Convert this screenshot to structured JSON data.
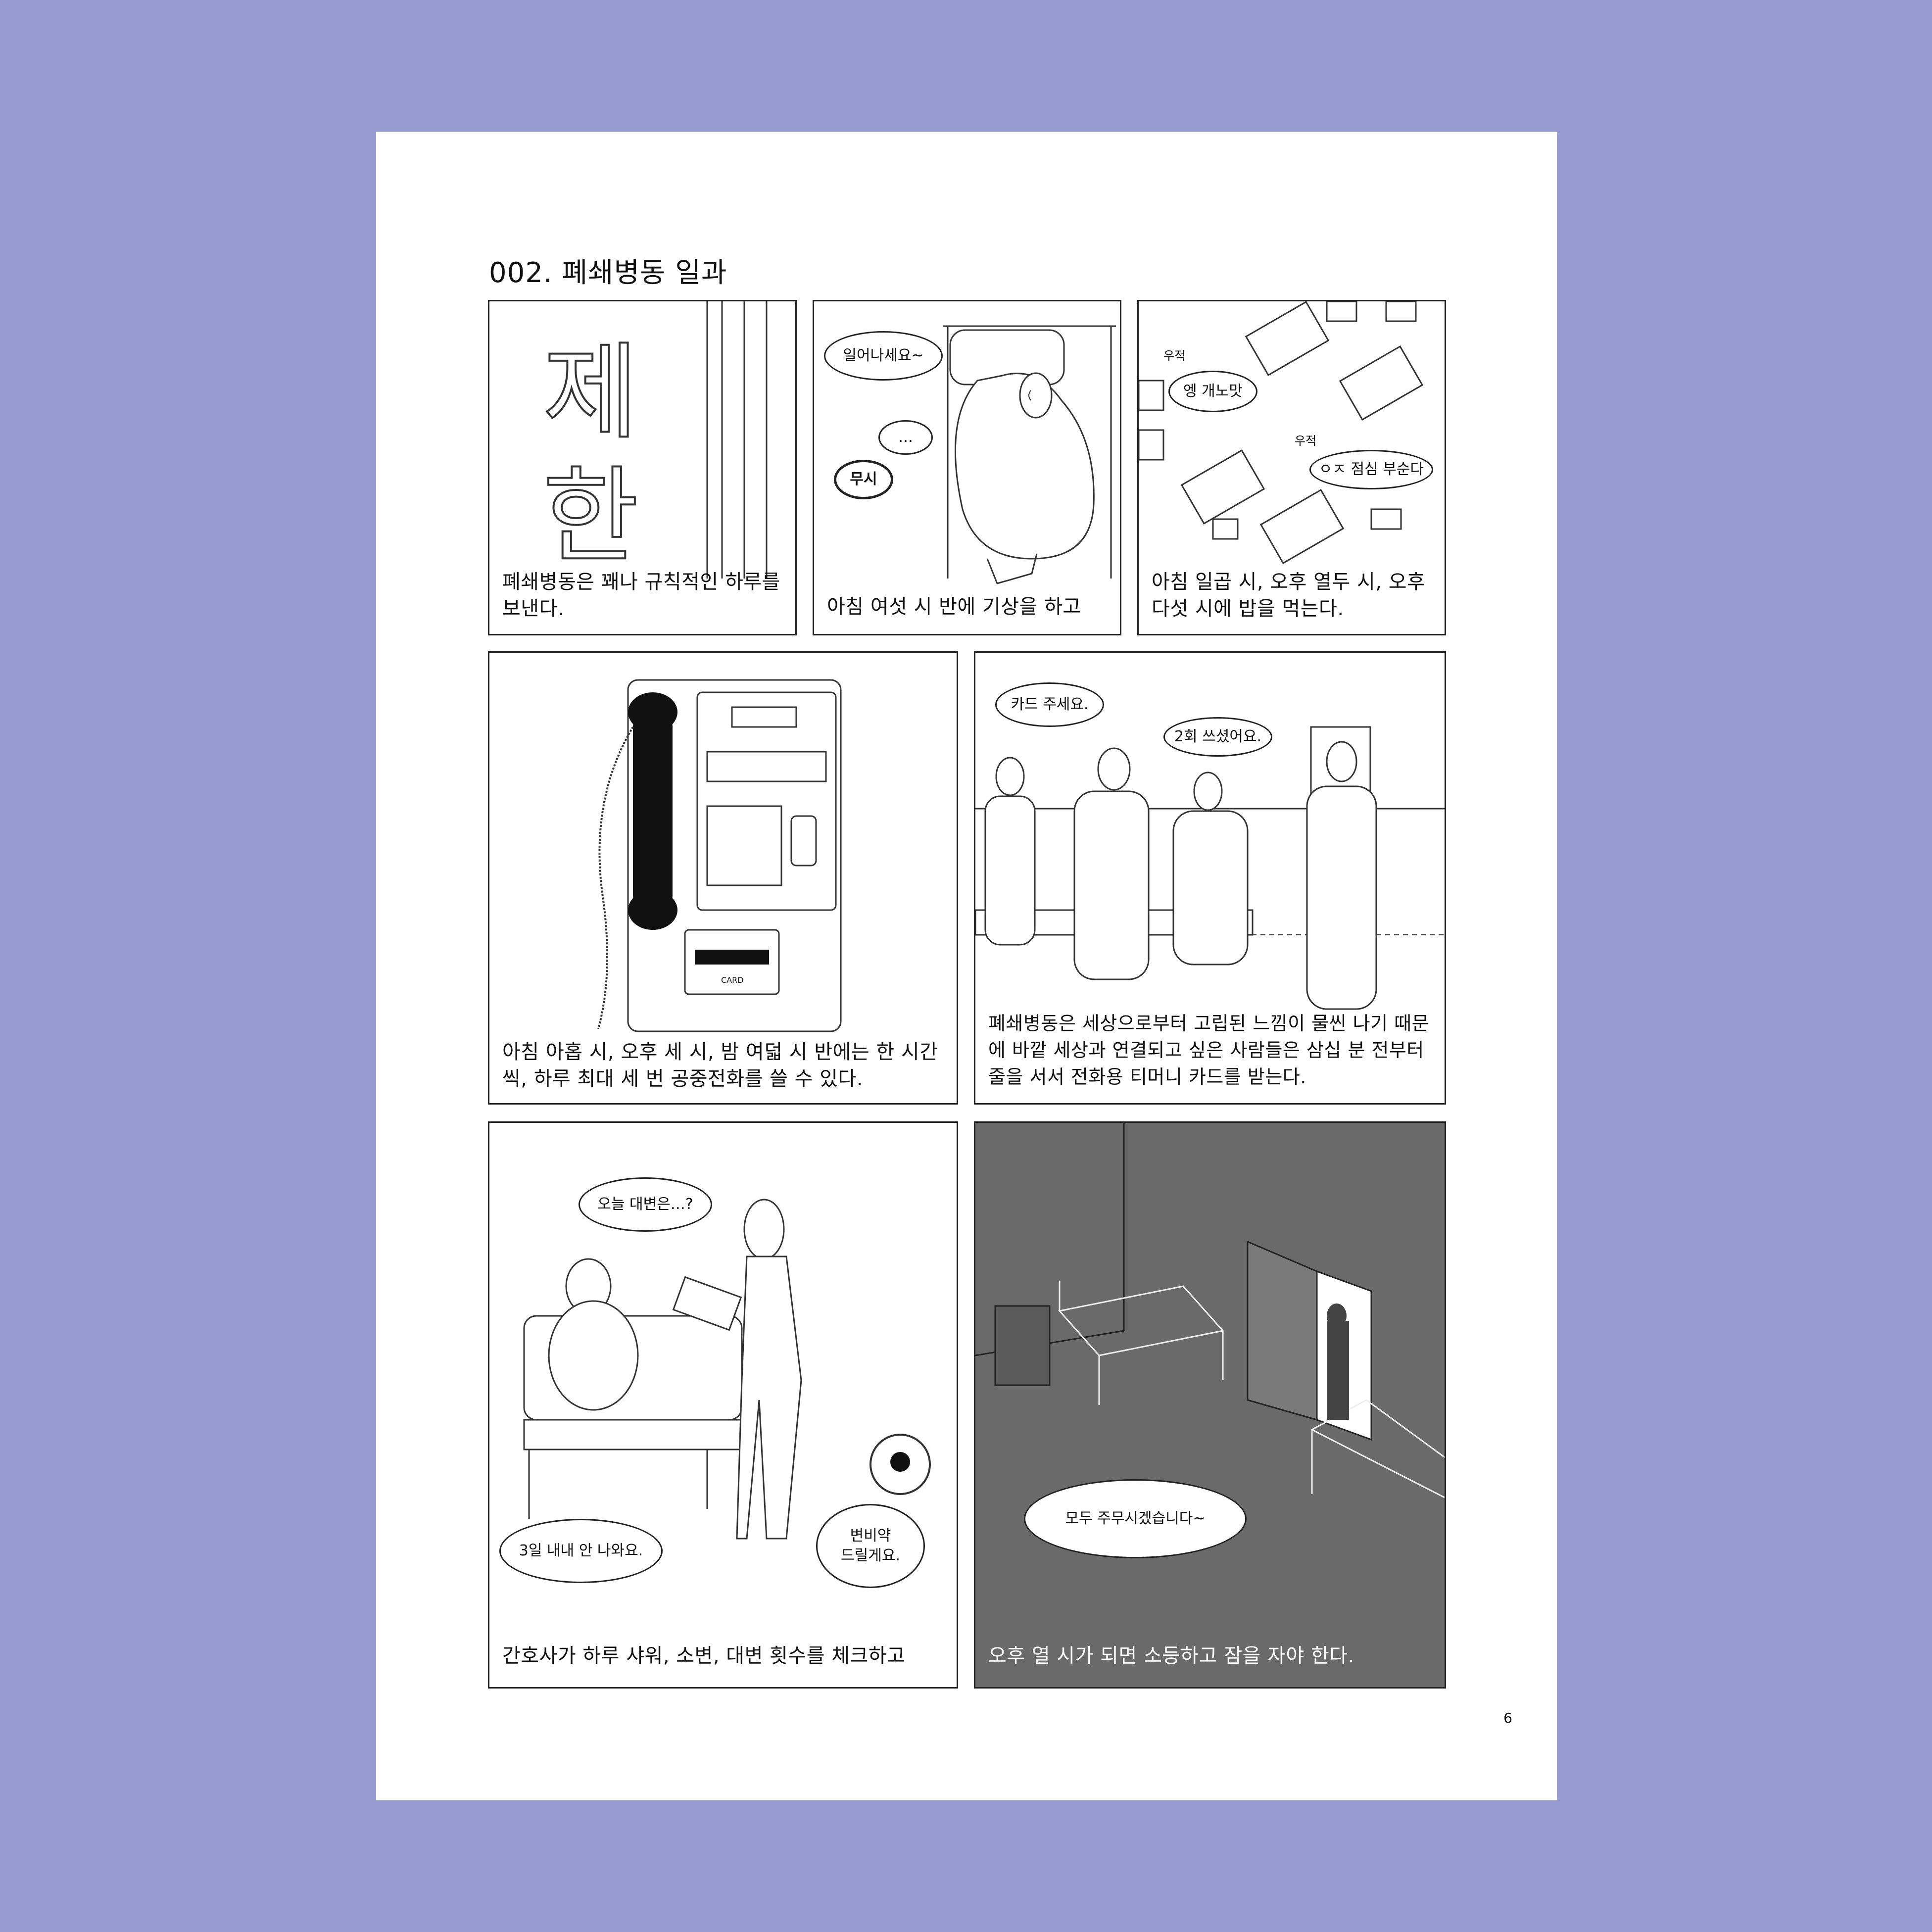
{
  "page": {
    "title": "002. 폐쇄병동 일과",
    "number": "6"
  },
  "panels": {
    "p1": {
      "sign_chars": [
        "제",
        "한"
      ],
      "caption": "폐쇄병동은 꽤나 규칙적인 하루를 보낸다."
    },
    "p2": {
      "bubbles": [
        "일어나세요~",
        "…"
      ],
      "sfx": "무시",
      "caption": "아침 여섯 시 반에 기상을 하고"
    },
    "p3": {
      "bubbles": [
        "엥 개노맛",
        "ㅇㅈ 점심 부순다"
      ],
      "sfx": [
        "우적",
        "우적"
      ],
      "caption": "아침 일곱 시, 오후 열두 시, 오후 다섯 시에 밥을 먹는다."
    },
    "p4": {
      "phone_label": "CARD",
      "caption": "아침 아홉 시, 오후 세 시, 밤 여덟 시 반에는 한 시간씩, 하루 최대 세 번 공중전화를 쓸 수 있다."
    },
    "p5": {
      "bubbles": [
        "카드 주세요.",
        "2회 쓰셨어요."
      ],
      "caption": "폐쇄병동은 세상으로부터 고립된 느낌이 물씬 나기 때문에 바깥 세상과 연결되고 싶은 사람들은 삼십 분 전부터 줄을 서서 전화용 티머니 카드를 받는다."
    },
    "p6": {
      "bubbles": [
        "오늘 대변은…?",
        "3일 내내 안 나와요.",
        "변비약\n드릴게요."
      ],
      "caption": "간호사가 하루 샤워, 소변, 대변 횟수를 체크하고"
    },
    "p7": {
      "bubbles": [
        "모두 주무시겠습니다~"
      ],
      "caption": "오후 열 시가 되면 소등하고 잠을 자야 한다."
    }
  },
  "colors": {
    "background": "#959bce",
    "page": "#ffffff",
    "night_panel": "#6a6a6a",
    "ink": "#222222"
  }
}
